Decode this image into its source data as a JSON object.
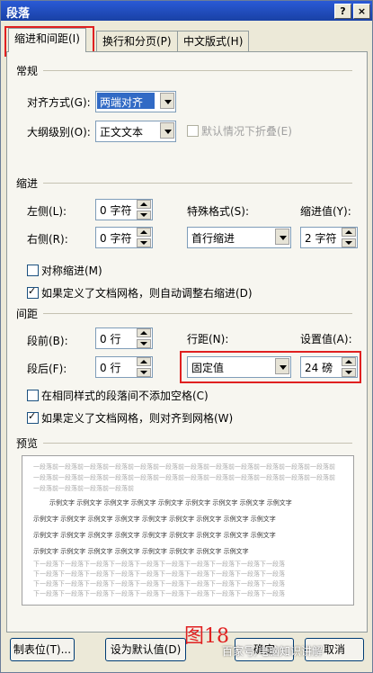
{
  "window": {
    "title": "段落",
    "help": "?",
    "close": "×"
  },
  "tabs": [
    {
      "label": "缩进和间距(I)",
      "active": true
    },
    {
      "label": "换行和分页(P)",
      "active": false
    },
    {
      "label": "中文版式(H)",
      "active": false
    }
  ],
  "general": {
    "section": "常规",
    "align_label": "对齐方式(G):",
    "align_value": "两端对齐",
    "outline_label": "大纲级别(O):",
    "outline_value": "正文文本",
    "collapse_label": "默认情况下折叠(E)"
  },
  "indent": {
    "section": "缩进",
    "left_label": "左侧(L):",
    "left_value": "0 字符",
    "right_label": "右侧(R):",
    "right_value": "0 字符",
    "special_label": "特殊格式(S):",
    "special_value": "首行缩进",
    "by_label": "缩进值(Y):",
    "by_value": "2 字符",
    "mirror_label": "对称缩进(M)",
    "auto_right_label": "如果定义了文档网格，则自动调整右缩进(D)"
  },
  "spacing": {
    "section": "间距",
    "before_label": "段前(B):",
    "before_value": "0 行",
    "after_label": "段后(F):",
    "after_value": "0 行",
    "line_label": "行距(N):",
    "line_value": "固定值",
    "at_label": "设置值(A):",
    "at_value": "24 磅",
    "no_space_label": "在相同样式的段落间不添加空格(C)",
    "snap_grid_label": "如果定义了文档网格，则对齐到网格(W)"
  },
  "preview": {
    "section": "预览",
    "lines": [
      "一段落前一段落前一段落前一段落前一段落前一段落前一段落前一段落前一段落前一段落前一段落前一段落前",
      "一段落前一段落前一段落前一段落前一段落前一段落前一段落前一段落前一段落前一段落前一段落前一段落前",
      "一段落前一段落前一段落前一段落前",
      "示例文字 示例文字 示例文字 示例文字 示例文字 示例文字 示例文字 示例文字 示例文字",
      "示例文字 示例文字 示例文字 示例文字 示例文字 示例文字 示例文字 示例文字 示例文字",
      "示例文字 示例文字 示例文字 示例文字 示例文字 示例文字 示例文字 示例文字 示例文字",
      "示例文字 示例文字 示例文字 示例文字 示例文字 示例文字 示例文字 示例文字",
      "下一段落下一段落下一段落下一段落下一段落下一段落下一段落下一段落下一段落下一段落",
      "下一段落下一段落下一段落下一段落下一段落下一段落下一段落下一段落下一段落下一段落",
      "下一段落下一段落下一段落下一段落下一段落下一段落下一段落下一段落下一段落下一段落",
      "下一段落下一段落下一段落下一段落下一段落下一段落下一段落下一段落下一段落下一段落",
      "段落下一段落下一段落下一段落"
    ]
  },
  "buttons": {
    "tabs": "制表位(T)...",
    "default": "设为默认值(D)",
    "ok": "确定",
    "cancel": "取消"
  },
  "annotation": "图18",
  "watermark": "百家号/电脑知识讲解"
}
